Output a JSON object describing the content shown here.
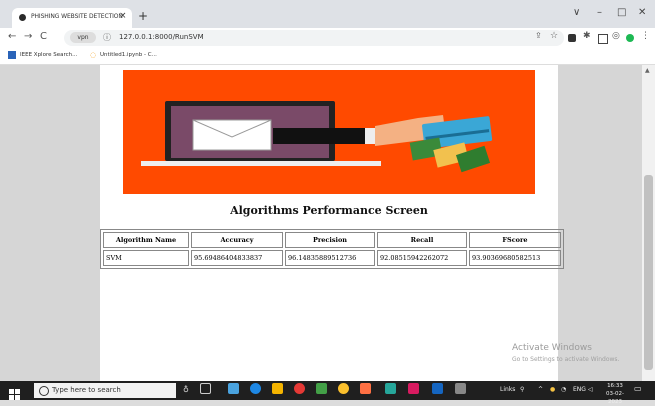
{
  "browser": {
    "tab_title": "PHISHING WEBSITE DETECTION",
    "tab_close": "×",
    "new_tab": "+",
    "url": "127.0.0.1:8000/RunSVM",
    "bookmarks": [
      "IEEE Xplore Search...",
      "Untitled1.ipynb - C..."
    ],
    "window_controls": [
      "∨",
      "–",
      "□",
      "✕"
    ]
  },
  "page": {
    "heading": "Algorithms Performance Screen",
    "table": {
      "headers": [
        "Algorithm Name",
        "Accuracy",
        "Precision",
        "Recall",
        "FScore"
      ],
      "rows": [
        [
          "SVM",
          "95.69486404833837",
          "96.14835889512736",
          "92.08515942262072",
          "93.90369680582513"
        ]
      ]
    }
  },
  "watermark": {
    "line1": "Activate Windows",
    "line2": "Go to Settings to activate Windows."
  },
  "taskbar": {
    "search_placeholder": "Type here to search",
    "links": "Links",
    "time": "16:33",
    "date": "03-02-2023"
  },
  "colors": {
    "banner": "#ff4a00",
    "laptop_screen": "#7a4a68",
    "card": "#3aa7d6",
    "money": "#3a8a3a"
  }
}
